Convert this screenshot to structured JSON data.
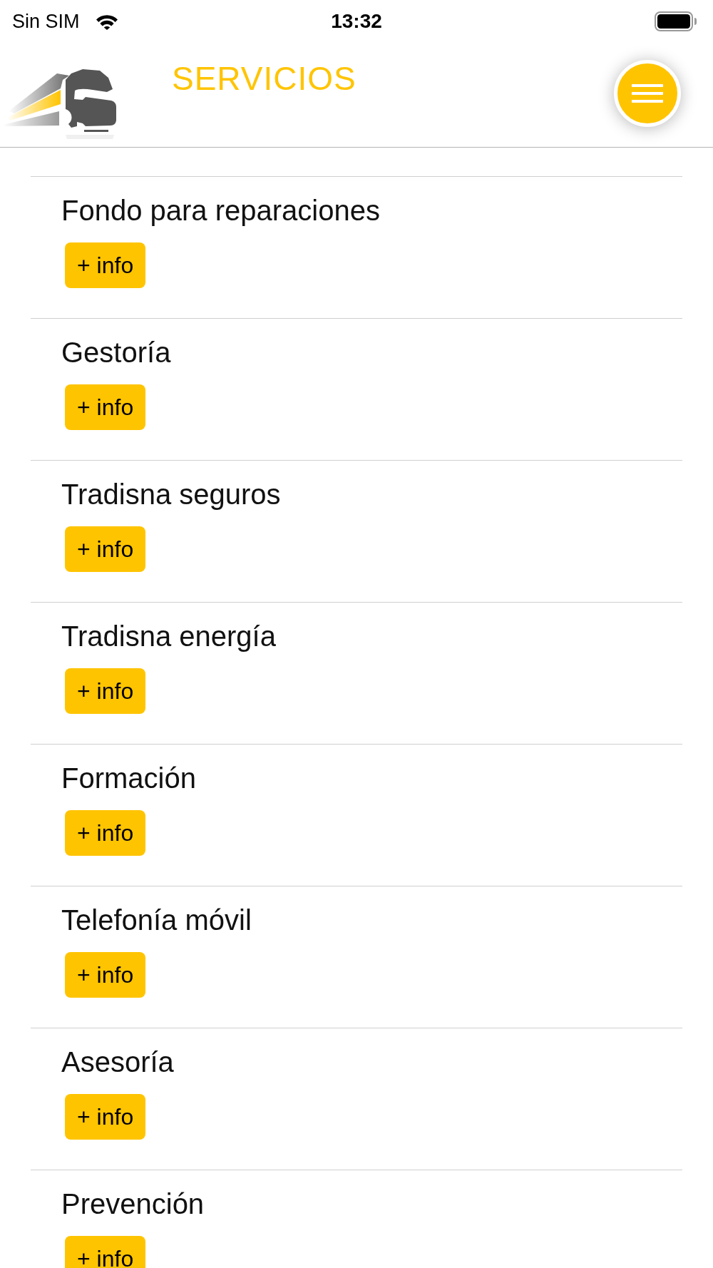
{
  "status_bar": {
    "carrier": "Sin SIM",
    "time": "13:32"
  },
  "header": {
    "title": "SERVICIOS"
  },
  "services": [
    {
      "title": "Fondo para reparaciones",
      "button": "+ info"
    },
    {
      "title": "Gestoría",
      "button": "+ info"
    },
    {
      "title": "Tradisna seguros",
      "button": "+ info"
    },
    {
      "title": "Tradisna energía",
      "button": "+ info"
    },
    {
      "title": "Formación",
      "button": "+ info"
    },
    {
      "title": "Telefonía móvil",
      "button": "+ info"
    },
    {
      "title": "Asesoría",
      "button": "+ info"
    },
    {
      "title": "Prevención",
      "button": "+ info"
    }
  ]
}
